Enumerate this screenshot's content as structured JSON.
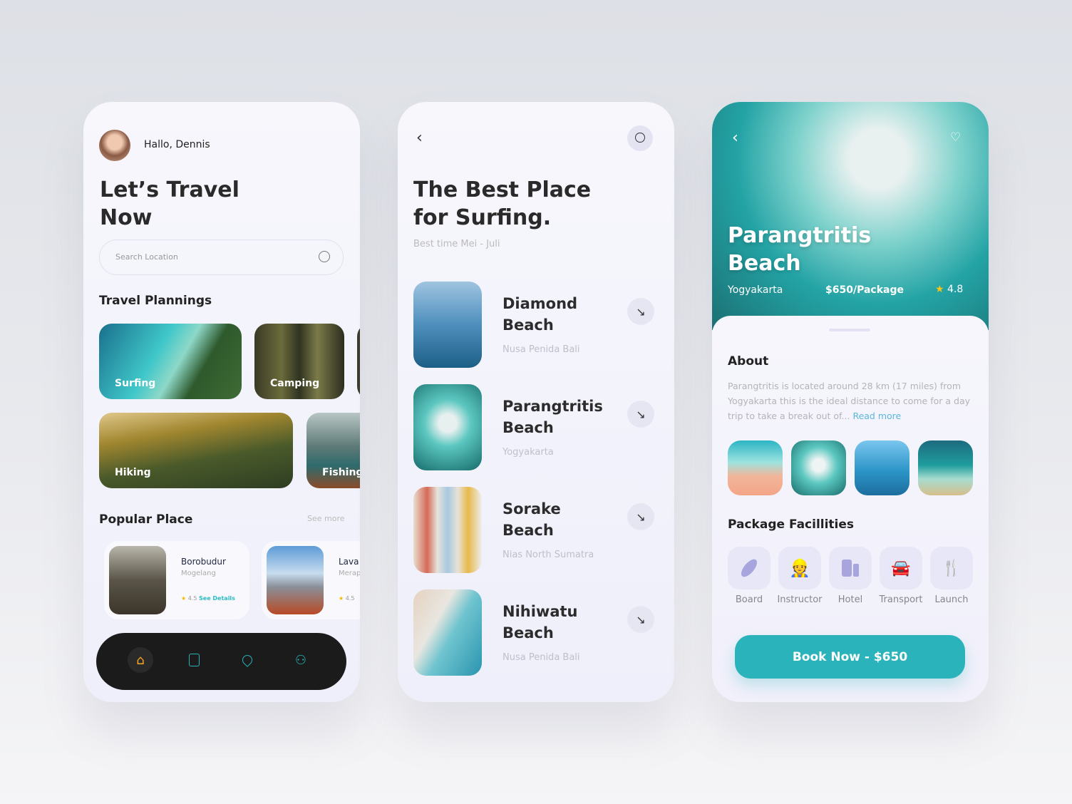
{
  "screen1": {
    "greeting": "Hallo, Dennis",
    "title_line1": "Let’s Travel",
    "title_line2": "Now",
    "search": {
      "placeholder": "Search Location"
    },
    "plannings_title": "Travel Plannings",
    "plannings": [
      {
        "label": "Surfing"
      },
      {
        "label": "Camping"
      },
      {
        "label": "Hiking"
      },
      {
        "label": "Fishing"
      }
    ],
    "popular_title": "Popular Place",
    "see_more": "See more",
    "places": [
      {
        "name": "Borobudur",
        "location": "Mogelang",
        "rating": "4.5",
        "details": "See Details"
      },
      {
        "name": "Lava",
        "location": "Merap",
        "rating": "4.5"
      }
    ],
    "nav": [
      "home-icon",
      "document-icon",
      "location-icon",
      "profile-icon"
    ],
    "accent": "#f5a623"
  },
  "screen2": {
    "title_line1": "The Best Place",
    "title_line2": "for Surfing.",
    "subtitle": "Best time Mei - Juli",
    "beaches": [
      {
        "name1": "Diamond",
        "name2": "Beach",
        "location": "Nusa Penida Bali"
      },
      {
        "name1": "Parangtritis",
        "name2": "Beach",
        "location": "Yogyakarta"
      },
      {
        "name1": "Sorake",
        "name2": "Beach",
        "location": "Nias North Sumatra"
      },
      {
        "name1": "Nihiwatu",
        "name2": "Beach",
        "location": "Nusa Penida Bali"
      }
    ]
  },
  "screen3": {
    "title_line1": "Parangtritis",
    "title_line2": "Beach",
    "location": "Yogyakarta",
    "price": "$650/Package",
    "rating": "4.8",
    "about_title": "About",
    "about_text": "Parangtritis is located around 28 km (17 miles) from Yogyakarta this is the ideal distance to come for a day trip to take a break out of...",
    "read_more": "Read more",
    "facilities_title": "Package Facillities",
    "facilities": [
      {
        "label": "Board"
      },
      {
        "label": "Instructor"
      },
      {
        "label": "Hotel"
      },
      {
        "label": "Transport"
      },
      {
        "label": "Launch"
      }
    ],
    "book_label": "Book Now - $650",
    "brand": "#2bb3bb"
  }
}
